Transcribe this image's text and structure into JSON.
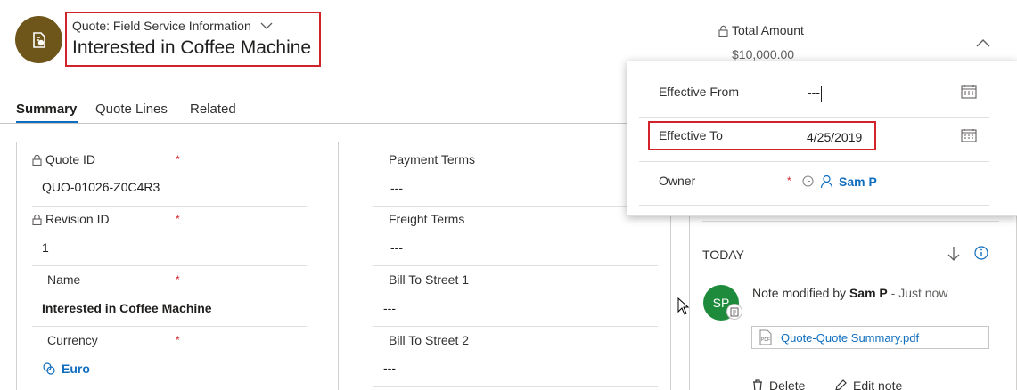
{
  "header": {
    "form_selector": "Quote: Field Service Information",
    "record_title": "Interested in Coffee Machine",
    "total_amount_label": "Total Amount",
    "total_amount_value": "$10,000.00"
  },
  "tabs": [
    {
      "label": "Summary",
      "active": true
    },
    {
      "label": "Quote Lines",
      "active": false
    },
    {
      "label": "Related",
      "active": false
    }
  ],
  "left_card": {
    "fields": [
      {
        "label": "Quote ID",
        "value": "QUO-01026-Z0C4R3",
        "required": "*",
        "locked": true
      },
      {
        "label": "Revision ID",
        "value": "1",
        "required": "*",
        "locked": true
      },
      {
        "label": "Name",
        "value": "Interested in Coffee Machine",
        "required": "*",
        "locked": false
      },
      {
        "label": "Currency",
        "value": "Euro",
        "required": "*",
        "locked": false
      }
    ]
  },
  "middle_card": {
    "fields": [
      {
        "label": "Payment Terms",
        "value": "---"
      },
      {
        "label": "Freight Terms",
        "value": "---"
      },
      {
        "label": "Bill To Street 1",
        "value": "---"
      },
      {
        "label": "Bill To Street 2",
        "value": "---"
      }
    ]
  },
  "flyout": {
    "effective_from_label": "Effective From",
    "effective_from_value": "---",
    "effective_to_label": "Effective To",
    "effective_to_value": "4/25/2019",
    "owner_label": "Owner",
    "owner_required": "*",
    "owner_value": "Sam P"
  },
  "timeline": {
    "section_label": "TODAY",
    "avatar_initials": "SP",
    "note_prefix": "Note modified by",
    "note_author": "Sam P",
    "note_suffix": "- Just now",
    "attachment_name": "Quote-Quote Summary.pdf",
    "attachment_badge": "PDF",
    "delete_label": "Delete",
    "edit_label": "Edit note"
  },
  "colors": {
    "accent": "#106ebe",
    "highlight": "#d1232a",
    "entity_icon": "#6e5519",
    "avatar": "#1e8a3b"
  }
}
